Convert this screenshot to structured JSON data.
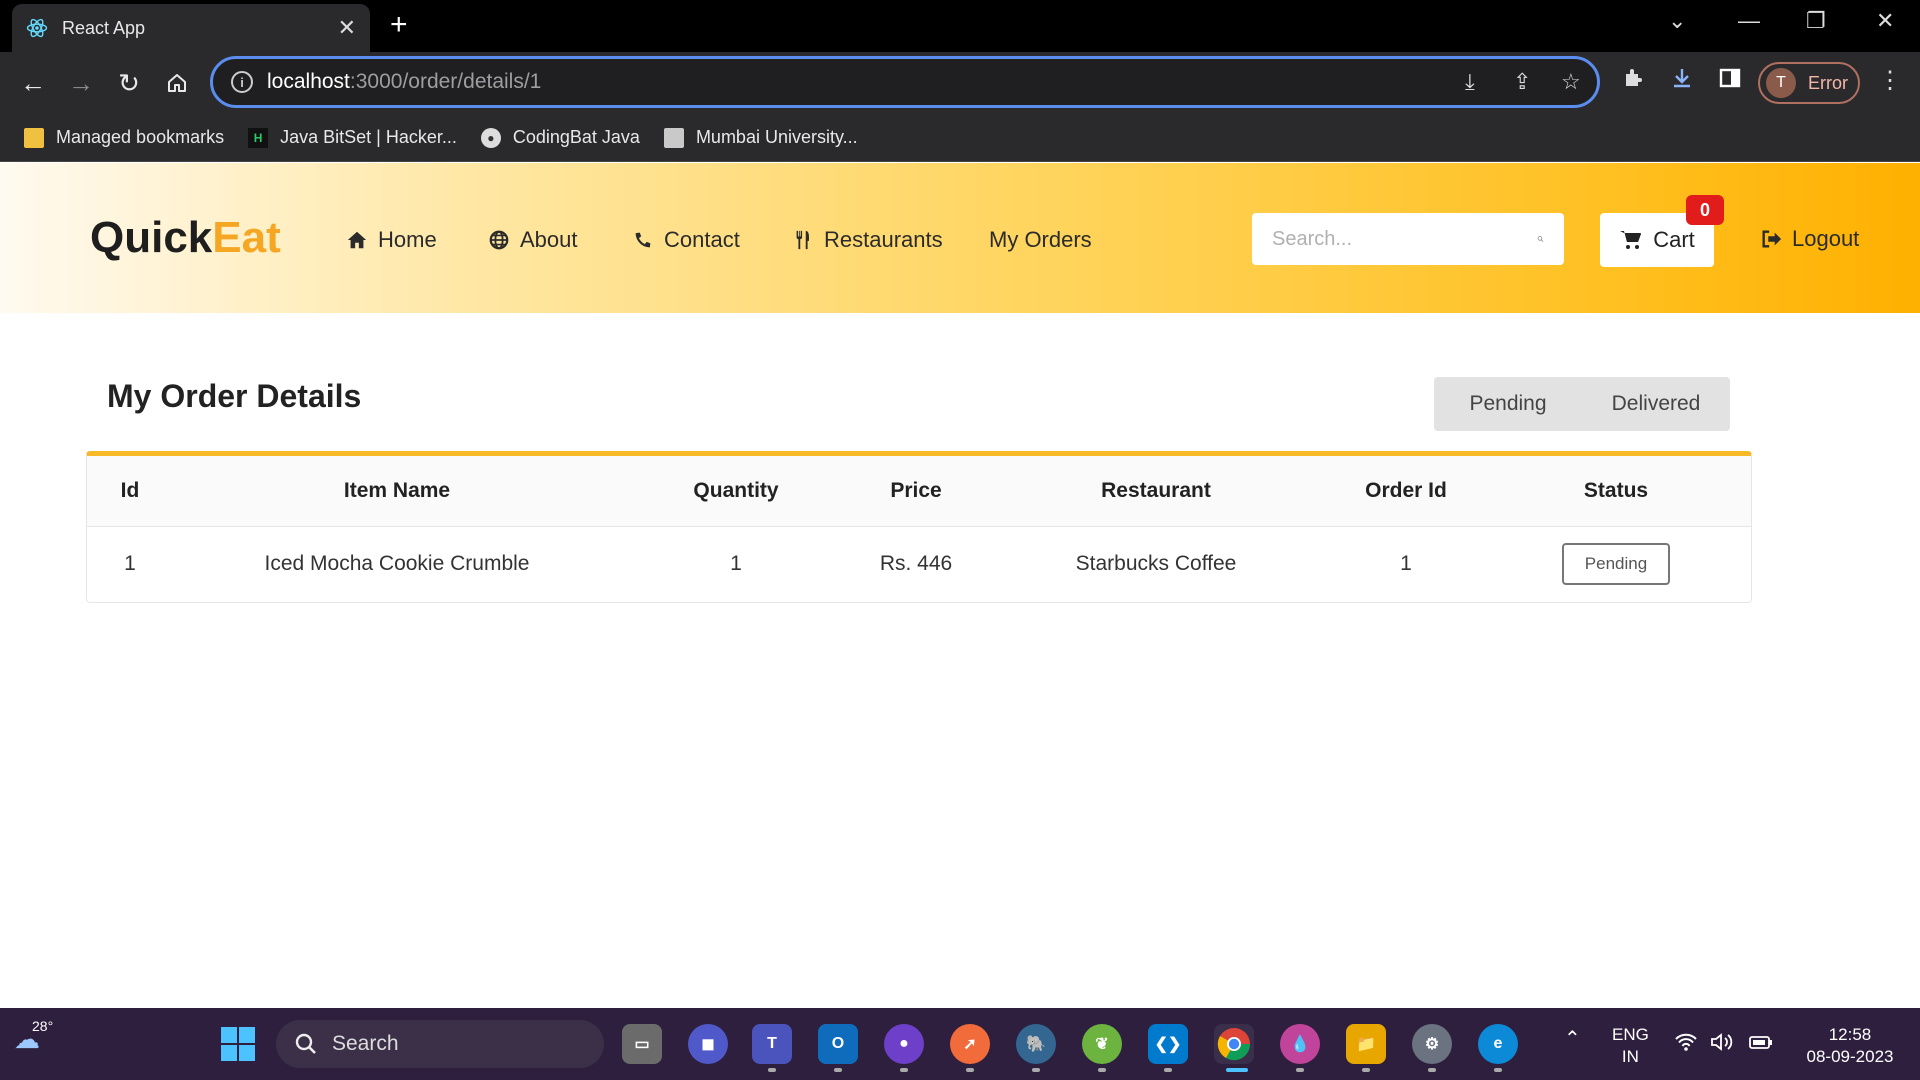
{
  "browser": {
    "tab_title": "React App",
    "url_host": "localhost",
    "url_path": ":3000/order/details/1",
    "profile_initial": "T",
    "profile_status": "Error",
    "bookmarks": [
      {
        "label": "Managed bookmarks",
        "icon": "folder-icon"
      },
      {
        "label": "Java BitSet | Hacker...",
        "icon": "hackerrank-icon"
      },
      {
        "label": "CodingBat Java",
        "icon": "globe-icon"
      },
      {
        "label": "Mumbai University...",
        "icon": "university-icon"
      }
    ]
  },
  "app": {
    "logo_part1": "Quick",
    "logo_part2": "Eat",
    "nav": {
      "home": "Home",
      "about": "About",
      "contact": "Contact",
      "restaurants": "Restaurants",
      "my_orders": "My Orders"
    },
    "search_placeholder": "Search...",
    "cart_label": "Cart",
    "cart_count": "0",
    "logout_label": "Logout",
    "accent_color": "#f5a623"
  },
  "main": {
    "title": "My Order Details",
    "filters": {
      "pending": "Pending",
      "delivered": "Delivered"
    },
    "table": {
      "headers": {
        "id": "Id",
        "item_name": "Item Name",
        "quantity": "Quantity",
        "price": "Price",
        "restaurant": "Restaurant",
        "order_id": "Order Id",
        "status": "Status"
      },
      "rows": [
        {
          "id": "1",
          "item_name": "Iced Mocha Cookie Crumble",
          "quantity": "1",
          "price": "Rs. 446",
          "restaurant": "Starbucks Coffee",
          "order_id": "1",
          "status": "Pending"
        }
      ]
    }
  },
  "taskbar": {
    "temperature": "28°",
    "search_label": "Search",
    "lang_line1": "ENG",
    "lang_line2": "IN",
    "time": "12:58",
    "date": "08-09-2023"
  }
}
